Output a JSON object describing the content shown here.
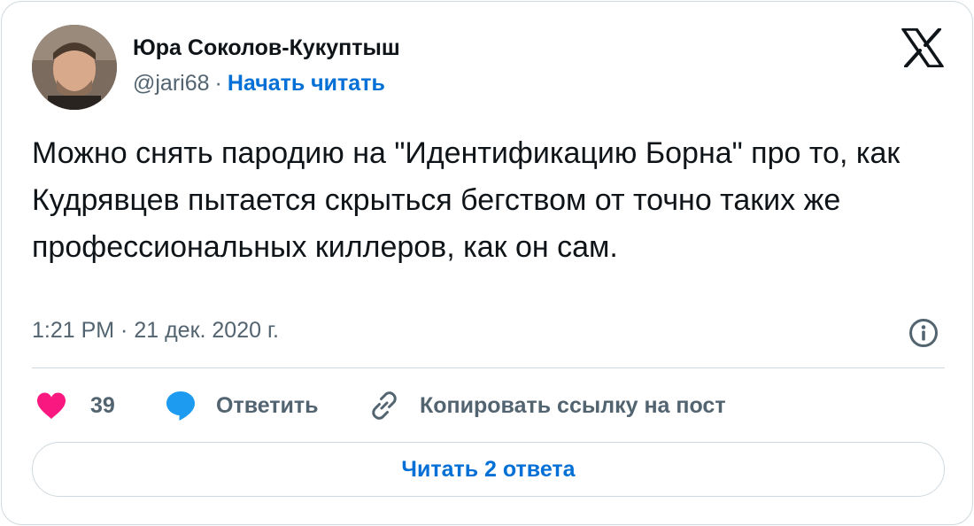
{
  "author": {
    "display_name": "Юра Соколов-Кукуптыш",
    "handle": "@jari68",
    "separator": "·",
    "follow_label": "Начать читать"
  },
  "tweet": {
    "text": "Можно снять пародию на \"Идентификацию Борна\" про то, как Кудрявцев пытается скрыться бегством от точно таких же профессиональных киллеров, как он сам.",
    "timestamp": "1:21 PM · 21 дек. 2020 г."
  },
  "actions": {
    "like_count": "39",
    "reply_label": "Ответить",
    "copy_link_label": "Копировать ссылку на пост"
  },
  "replies_button_label": "Читать 2 ответа",
  "icons": {
    "logo": "x-logo-icon",
    "info": "info-icon",
    "like": "heart-icon",
    "reply": "speech-bubble-icon",
    "copy": "link-icon"
  },
  "colors": {
    "text": "#0f1419",
    "secondary": "#536471",
    "link": "#006fd6",
    "heart": "#f91880",
    "reply_bubble": "#1d9bf0",
    "border": "#cfd9de"
  }
}
